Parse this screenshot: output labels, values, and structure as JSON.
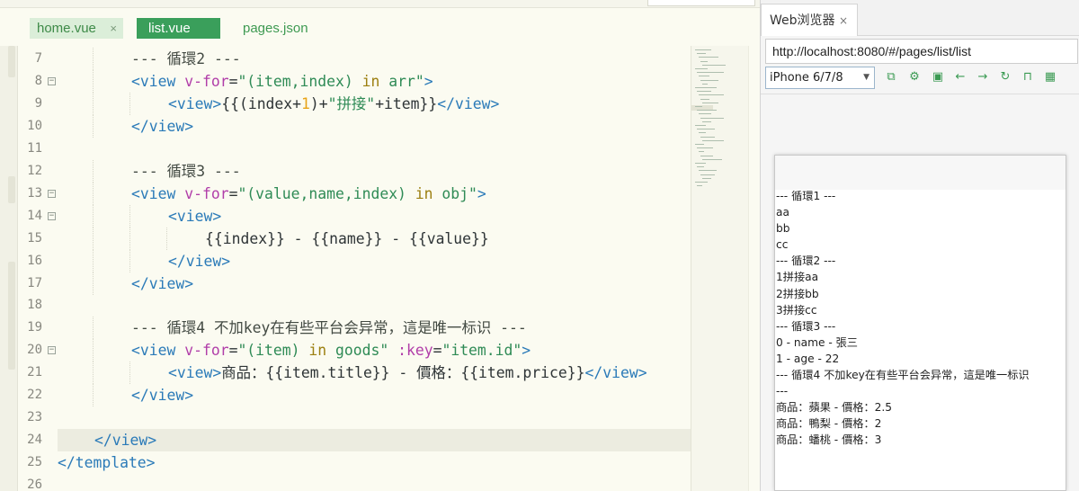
{
  "editor": {
    "tabs": [
      {
        "label": "home.vue",
        "close": "×"
      },
      {
        "label": "list.vue"
      },
      {
        "label": "pages.json"
      }
    ],
    "lines": [
      {
        "num": "7",
        "fold": false,
        "indent": 2,
        "tokens": [
          [
            "c",
            "--- 循環2 ---"
          ]
        ]
      },
      {
        "num": "8",
        "fold": true,
        "indent": 2,
        "tokens": [
          [
            "t",
            "<view "
          ],
          [
            "a",
            "v-for"
          ],
          [
            "p",
            "="
          ],
          [
            "s",
            "\"(item,index) "
          ],
          [
            "k",
            "in"
          ],
          [
            "s",
            " arr\""
          ],
          [
            "t",
            ">"
          ]
        ]
      },
      {
        "num": "9",
        "fold": false,
        "indent": 3,
        "tokens": [
          [
            "t",
            "<view>"
          ],
          [
            "p",
            "{{(index+"
          ],
          [
            "n",
            "1"
          ],
          [
            "p",
            ")+"
          ],
          [
            "s",
            "\"拼接\""
          ],
          [
            "p",
            "+item}}"
          ],
          [
            "t",
            "</view>"
          ]
        ]
      },
      {
        "num": "10",
        "fold": false,
        "indent": 2,
        "tokens": [
          [
            "t",
            "</view>"
          ]
        ]
      },
      {
        "num": "11",
        "fold": false,
        "indent": 0,
        "tokens": []
      },
      {
        "num": "12",
        "fold": false,
        "indent": 2,
        "tokens": [
          [
            "c",
            "--- 循環3 ---"
          ]
        ]
      },
      {
        "num": "13",
        "fold": true,
        "indent": 2,
        "tokens": [
          [
            "t",
            "<view "
          ],
          [
            "a",
            "v-for"
          ],
          [
            "p",
            "="
          ],
          [
            "s",
            "\"(value,name,index) "
          ],
          [
            "k",
            "in"
          ],
          [
            "s",
            " obj\""
          ],
          [
            "t",
            ">"
          ]
        ]
      },
      {
        "num": "14",
        "fold": true,
        "indent": 3,
        "tokens": [
          [
            "t",
            "<view>"
          ]
        ]
      },
      {
        "num": "15",
        "fold": false,
        "indent": 4,
        "tokens": [
          [
            "p",
            "{{index}} - {{name}} - {{value}}"
          ]
        ]
      },
      {
        "num": "16",
        "fold": false,
        "indent": 3,
        "tokens": [
          [
            "t",
            "</view>"
          ]
        ]
      },
      {
        "num": "17",
        "fold": false,
        "indent": 2,
        "tokens": [
          [
            "t",
            "</view>"
          ]
        ]
      },
      {
        "num": "18",
        "fold": false,
        "indent": 0,
        "tokens": []
      },
      {
        "num": "19",
        "fold": false,
        "indent": 2,
        "tokens": [
          [
            "c",
            "--- 循環4 不加key在有些平台会异常，這是唯一标识 ---"
          ]
        ]
      },
      {
        "num": "20",
        "fold": true,
        "indent": 2,
        "tokens": [
          [
            "t",
            "<view "
          ],
          [
            "a",
            "v-for"
          ],
          [
            "p",
            "="
          ],
          [
            "s",
            "\"(item) "
          ],
          [
            "k",
            "in"
          ],
          [
            "s",
            " goods\" "
          ],
          [
            "a",
            ":key"
          ],
          [
            "p",
            "="
          ],
          [
            "s",
            "\"item.id\""
          ],
          [
            "t",
            ">"
          ]
        ]
      },
      {
        "num": "21",
        "fold": false,
        "indent": 3,
        "tokens": [
          [
            "t",
            "<view>"
          ],
          [
            "p",
            "商品：{{item.title}} - 價格：{{item.price}}"
          ],
          [
            "t",
            "</view>"
          ]
        ]
      },
      {
        "num": "22",
        "fold": false,
        "indent": 2,
        "tokens": [
          [
            "t",
            "</view>"
          ]
        ]
      },
      {
        "num": "23",
        "fold": false,
        "indent": 0,
        "tokens": []
      },
      {
        "num": "24",
        "fold": false,
        "indent": 1,
        "highlight": true,
        "tokens": [
          [
            "t",
            "</view>"
          ]
        ]
      },
      {
        "num": "25",
        "fold": false,
        "indent": 0,
        "tokens": [
          [
            "t",
            "</template>"
          ]
        ]
      },
      {
        "num": "26",
        "fold": false,
        "indent": 0,
        "tokens": []
      }
    ]
  },
  "browser": {
    "tab_label": "Web浏览器",
    "tab_close": "×",
    "url": "http://localhost:8080/#/pages/list/list",
    "device": "iPhone 6/7/8",
    "device_caret": "▼",
    "tool_icons": [
      "open-external-icon",
      "settings-icon",
      "screenshot-icon",
      "back-icon",
      "forward-icon",
      "refresh-icon",
      "lock-icon",
      "qrcode-icon"
    ],
    "tool_glyphs": [
      "⧉",
      "⚙",
      "▣",
      "←",
      "→",
      "↻",
      "⊓",
      "▦"
    ],
    "accent": "#3a9a52",
    "page_lines": [
      "--- 循環1 ---",
      "aa",
      "bb",
      "cc",
      "--- 循環2 ---",
      "1拼接aa",
      "2拼接bb",
      "3拼接cc",
      "--- 循環3 ---",
      "0 - name - 張三",
      "1 - age - 22",
      "--- 循環4 不加key在有些平台会异常，這是唯一标识",
      "---",
      "商品：蘋果 - 價格：2.5",
      "商品：鴨梨 - 價格：2",
      "商品：蟠桃 - 價格：3"
    ]
  }
}
